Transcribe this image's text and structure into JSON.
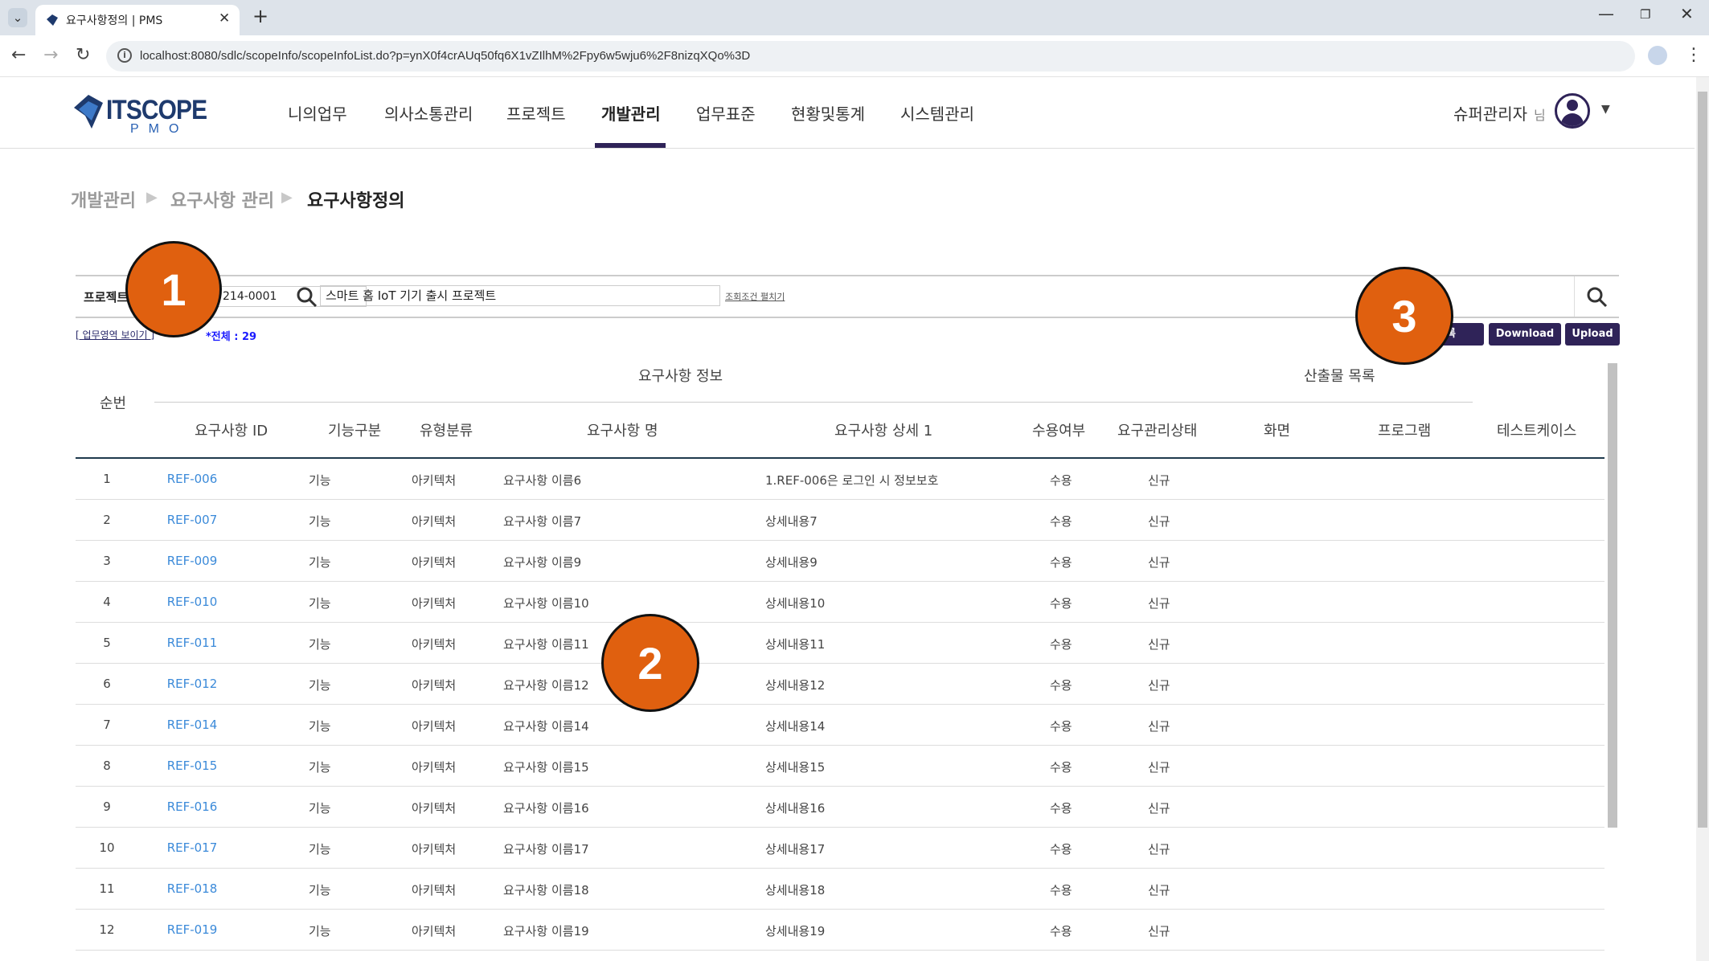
{
  "browser": {
    "tab_title": "요구사항정의 | PMS",
    "url": "localhost:8080/sdlc/scopeInfo/scopeInfoList.do?p=ynX0f4crAUq50fq6X1vZIlhM%2Fpy6w5wju6%2F8nizqXQo%3D"
  },
  "header": {
    "logo_text": "ITSCOPE",
    "logo_sub": "PMO",
    "nav": [
      "니의업무",
      "의사소통관리",
      "프로젝트",
      "개발관리",
      "업무표준",
      "현황및통계",
      "시스템관리"
    ],
    "active_nav": "개발관리",
    "user_name": "슈퍼관리자",
    "user_suffix": "님"
  },
  "breadcrumb": [
    "개발관리",
    "요구사항 관리",
    "요구사항정의"
  ],
  "search": {
    "project_label": "프로젝트",
    "project_code": "214-0001",
    "project_name": "스마트 홈 IoT 기기 출시 프로젝트",
    "expand_link": "조회조건 펼치기"
  },
  "toolbar": {
    "toggle_area": "[ 업무영역 보이기 ]",
    "total": "*전체 : 29",
    "register": "등록",
    "download": "Download",
    "upload": "Upload"
  },
  "table": {
    "group_info": "요구사항 정보",
    "group_output": "산출물 목록",
    "col_no": "순번",
    "columns": [
      "요구사항 ID",
      "기능구분",
      "유형분류",
      "요구사항 명",
      "요구사항 상세 1",
      "수용여부",
      "요구관리상태",
      "화면",
      "프로그램",
      "테스트케이스"
    ],
    "rows": [
      {
        "no": "1",
        "id": "REF-006",
        "func": "기능",
        "type": "아키텍처",
        "name": "요구사항 이름6",
        "detail": "1.REF-006은 로그인 시 정보보호",
        "accept": "수용",
        "status": "신규"
      },
      {
        "no": "2",
        "id": "REF-007",
        "func": "기능",
        "type": "아키텍처",
        "name": "요구사항 이름7",
        "detail": "상세내용7",
        "accept": "수용",
        "status": "신규"
      },
      {
        "no": "3",
        "id": "REF-009",
        "func": "기능",
        "type": "아키텍처",
        "name": "요구사항 이름9",
        "detail": "상세내용9",
        "accept": "수용",
        "status": "신규"
      },
      {
        "no": "4",
        "id": "REF-010",
        "func": "기능",
        "type": "아키텍처",
        "name": "요구사항 이름10",
        "detail": "상세내용10",
        "accept": "수용",
        "status": "신규"
      },
      {
        "no": "5",
        "id": "REF-011",
        "func": "기능",
        "type": "아키텍처",
        "name": "요구사항 이름11",
        "detail": "상세내용11",
        "accept": "수용",
        "status": "신규"
      },
      {
        "no": "6",
        "id": "REF-012",
        "func": "기능",
        "type": "아키텍처",
        "name": "요구사항 이름12",
        "detail": "상세내용12",
        "accept": "수용",
        "status": "신규"
      },
      {
        "no": "7",
        "id": "REF-014",
        "func": "기능",
        "type": "아키텍처",
        "name": "요구사항 이름14",
        "detail": "상세내용14",
        "accept": "수용",
        "status": "신규"
      },
      {
        "no": "8",
        "id": "REF-015",
        "func": "기능",
        "type": "아키텍처",
        "name": "요구사항 이름15",
        "detail": "상세내용15",
        "accept": "수용",
        "status": "신규"
      },
      {
        "no": "9",
        "id": "REF-016",
        "func": "기능",
        "type": "아키텍처",
        "name": "요구사항 이름16",
        "detail": "상세내용16",
        "accept": "수용",
        "status": "신규"
      },
      {
        "no": "10",
        "id": "REF-017",
        "func": "기능",
        "type": "아키텍처",
        "name": "요구사항 이름17",
        "detail": "상세내용17",
        "accept": "수용",
        "status": "신규"
      },
      {
        "no": "11",
        "id": "REF-018",
        "func": "기능",
        "type": "아키텍처",
        "name": "요구사항 이름18",
        "detail": "상세내용18",
        "accept": "수용",
        "status": "신규"
      },
      {
        "no": "12",
        "id": "REF-019",
        "func": "기능",
        "type": "아키텍처",
        "name": "요구사항 이름19",
        "detail": "상세내용19",
        "accept": "수용",
        "status": "신규"
      }
    ]
  },
  "callouts": [
    "1",
    "2",
    "3"
  ],
  "colors": {
    "accent": "#2f2358",
    "link": "#3b8ad9",
    "callout": "#e0600f"
  }
}
